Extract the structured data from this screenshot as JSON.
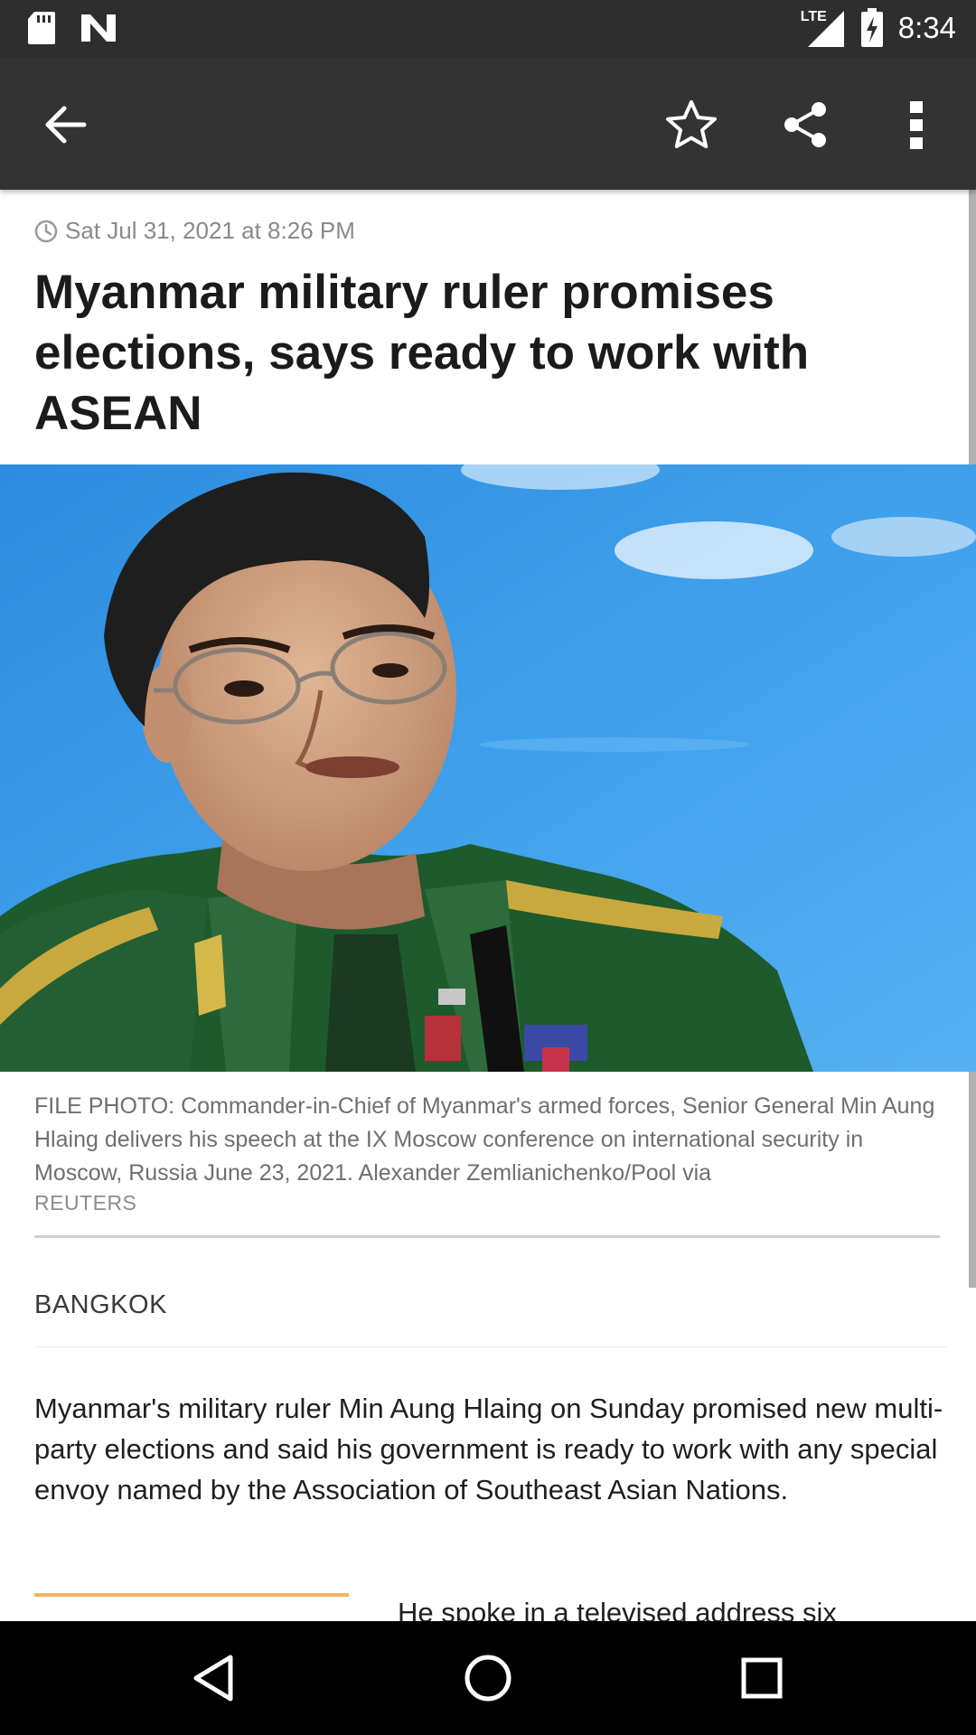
{
  "status_bar": {
    "time": "8:34",
    "network": "LTE",
    "left_icons": [
      "sd-card-icon",
      "n-app-icon"
    ],
    "right_icons": [
      "signal-icon",
      "battery-charging-icon"
    ]
  },
  "app_bar": {
    "actions": [
      "back-arrow-icon",
      "star-icon",
      "share-icon",
      "more-vert-icon"
    ],
    "background": "#333333"
  },
  "article": {
    "timestamp": "Sat Jul 31, 2021 at 8:26 PM",
    "headline": "Myanmar military ruler promises elections, says ready to work with ASEAN",
    "caption": "FILE PHOTO: Commander-in-Chief of Myanmar's armed forces, Senior General Min Aung Hlaing delivers his speech at the IX Moscow conference on international security in Moscow, Russia June 23, 2021. Alexander Zemlianichenko/Pool via",
    "caption_credit": "REUTERS",
    "dateline": "BANGKOK",
    "paragraph_1": "Myanmar's military ruler Min Aung Hlaing on Sunday promised new multi-party elections and said his government is ready to work with any special envoy named by the Association of Southeast Asian Nations.",
    "paragraph_2_partial": "He spoke in a televised address six",
    "accent_color": "#f2b560"
  },
  "nav_bar": {
    "buttons": [
      "back-triangle-icon",
      "home-circle-icon",
      "recents-square-icon"
    ]
  }
}
